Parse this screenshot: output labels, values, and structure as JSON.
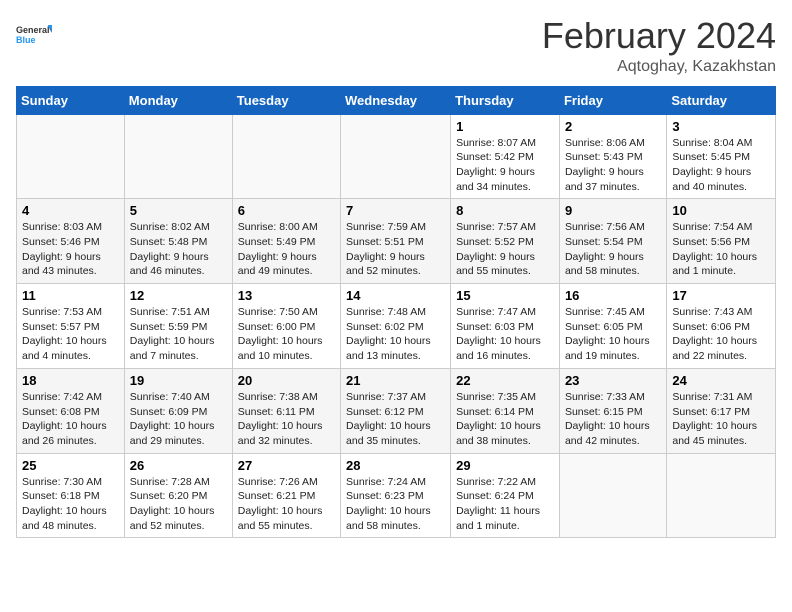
{
  "header": {
    "logo_line1": "General",
    "logo_line2": "Blue",
    "month": "February 2024",
    "location": "Aqtoghay, Kazakhstan"
  },
  "columns": [
    "Sunday",
    "Monday",
    "Tuesday",
    "Wednesday",
    "Thursday",
    "Friday",
    "Saturday"
  ],
  "weeks": [
    [
      {
        "day": "",
        "info": ""
      },
      {
        "day": "",
        "info": ""
      },
      {
        "day": "",
        "info": ""
      },
      {
        "day": "",
        "info": ""
      },
      {
        "day": "1",
        "info": "Sunrise: 8:07 AM\nSunset: 5:42 PM\nDaylight: 9 hours\nand 34 minutes."
      },
      {
        "day": "2",
        "info": "Sunrise: 8:06 AM\nSunset: 5:43 PM\nDaylight: 9 hours\nand 37 minutes."
      },
      {
        "day": "3",
        "info": "Sunrise: 8:04 AM\nSunset: 5:45 PM\nDaylight: 9 hours\nand 40 minutes."
      }
    ],
    [
      {
        "day": "4",
        "info": "Sunrise: 8:03 AM\nSunset: 5:46 PM\nDaylight: 9 hours\nand 43 minutes."
      },
      {
        "day": "5",
        "info": "Sunrise: 8:02 AM\nSunset: 5:48 PM\nDaylight: 9 hours\nand 46 minutes."
      },
      {
        "day": "6",
        "info": "Sunrise: 8:00 AM\nSunset: 5:49 PM\nDaylight: 9 hours\nand 49 minutes."
      },
      {
        "day": "7",
        "info": "Sunrise: 7:59 AM\nSunset: 5:51 PM\nDaylight: 9 hours\nand 52 minutes."
      },
      {
        "day": "8",
        "info": "Sunrise: 7:57 AM\nSunset: 5:52 PM\nDaylight: 9 hours\nand 55 minutes."
      },
      {
        "day": "9",
        "info": "Sunrise: 7:56 AM\nSunset: 5:54 PM\nDaylight: 9 hours\nand 58 minutes."
      },
      {
        "day": "10",
        "info": "Sunrise: 7:54 AM\nSunset: 5:56 PM\nDaylight: 10 hours\nand 1 minute."
      }
    ],
    [
      {
        "day": "11",
        "info": "Sunrise: 7:53 AM\nSunset: 5:57 PM\nDaylight: 10 hours\nand 4 minutes."
      },
      {
        "day": "12",
        "info": "Sunrise: 7:51 AM\nSunset: 5:59 PM\nDaylight: 10 hours\nand 7 minutes."
      },
      {
        "day": "13",
        "info": "Sunrise: 7:50 AM\nSunset: 6:00 PM\nDaylight: 10 hours\nand 10 minutes."
      },
      {
        "day": "14",
        "info": "Sunrise: 7:48 AM\nSunset: 6:02 PM\nDaylight: 10 hours\nand 13 minutes."
      },
      {
        "day": "15",
        "info": "Sunrise: 7:47 AM\nSunset: 6:03 PM\nDaylight: 10 hours\nand 16 minutes."
      },
      {
        "day": "16",
        "info": "Sunrise: 7:45 AM\nSunset: 6:05 PM\nDaylight: 10 hours\nand 19 minutes."
      },
      {
        "day": "17",
        "info": "Sunrise: 7:43 AM\nSunset: 6:06 PM\nDaylight: 10 hours\nand 22 minutes."
      }
    ],
    [
      {
        "day": "18",
        "info": "Sunrise: 7:42 AM\nSunset: 6:08 PM\nDaylight: 10 hours\nand 26 minutes."
      },
      {
        "day": "19",
        "info": "Sunrise: 7:40 AM\nSunset: 6:09 PM\nDaylight: 10 hours\nand 29 minutes."
      },
      {
        "day": "20",
        "info": "Sunrise: 7:38 AM\nSunset: 6:11 PM\nDaylight: 10 hours\nand 32 minutes."
      },
      {
        "day": "21",
        "info": "Sunrise: 7:37 AM\nSunset: 6:12 PM\nDaylight: 10 hours\nand 35 minutes."
      },
      {
        "day": "22",
        "info": "Sunrise: 7:35 AM\nSunset: 6:14 PM\nDaylight: 10 hours\nand 38 minutes."
      },
      {
        "day": "23",
        "info": "Sunrise: 7:33 AM\nSunset: 6:15 PM\nDaylight: 10 hours\nand 42 minutes."
      },
      {
        "day": "24",
        "info": "Sunrise: 7:31 AM\nSunset: 6:17 PM\nDaylight: 10 hours\nand 45 minutes."
      }
    ],
    [
      {
        "day": "25",
        "info": "Sunrise: 7:30 AM\nSunset: 6:18 PM\nDaylight: 10 hours\nand 48 minutes."
      },
      {
        "day": "26",
        "info": "Sunrise: 7:28 AM\nSunset: 6:20 PM\nDaylight: 10 hours\nand 52 minutes."
      },
      {
        "day": "27",
        "info": "Sunrise: 7:26 AM\nSunset: 6:21 PM\nDaylight: 10 hours\nand 55 minutes."
      },
      {
        "day": "28",
        "info": "Sunrise: 7:24 AM\nSunset: 6:23 PM\nDaylight: 10 hours\nand 58 minutes."
      },
      {
        "day": "29",
        "info": "Sunrise: 7:22 AM\nSunset: 6:24 PM\nDaylight: 11 hours\nand 1 minute."
      },
      {
        "day": "",
        "info": ""
      },
      {
        "day": "",
        "info": ""
      }
    ]
  ]
}
